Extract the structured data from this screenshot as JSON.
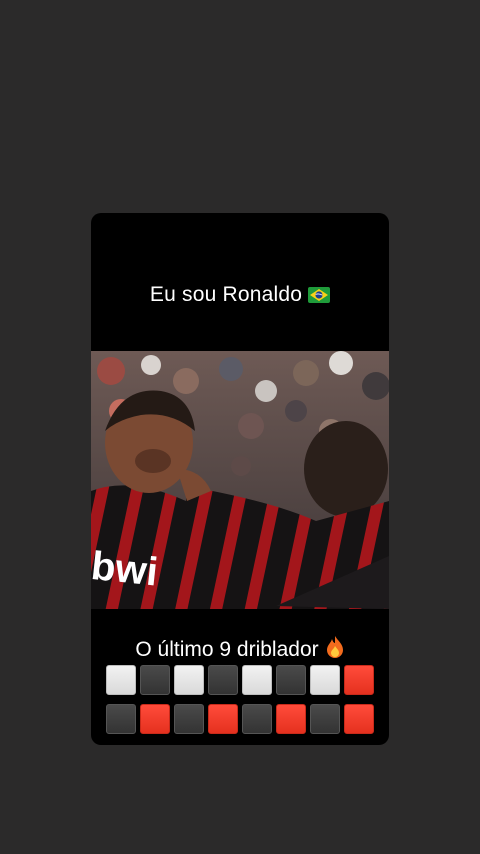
{
  "post": {
    "top_caption": "Eu sou Ronaldo",
    "top_caption_emoji": "brazil-flag",
    "bottom_caption": "O último 9 driblador",
    "bottom_caption_emoji": "fire"
  },
  "grid": {
    "row1": [
      "white",
      "gray",
      "white",
      "gray",
      "white",
      "gray",
      "white",
      "red"
    ],
    "row2": [
      "gray",
      "red",
      "gray",
      "red",
      "gray",
      "red",
      "gray",
      "red"
    ]
  },
  "colors": {
    "background": "#2b2a2a",
    "card": "#000000",
    "tile_white": "#e6e6e6",
    "tile_gray": "#3d3d3d",
    "tile_red": "#f03c2a",
    "jersey_red": "#b0171b"
  }
}
